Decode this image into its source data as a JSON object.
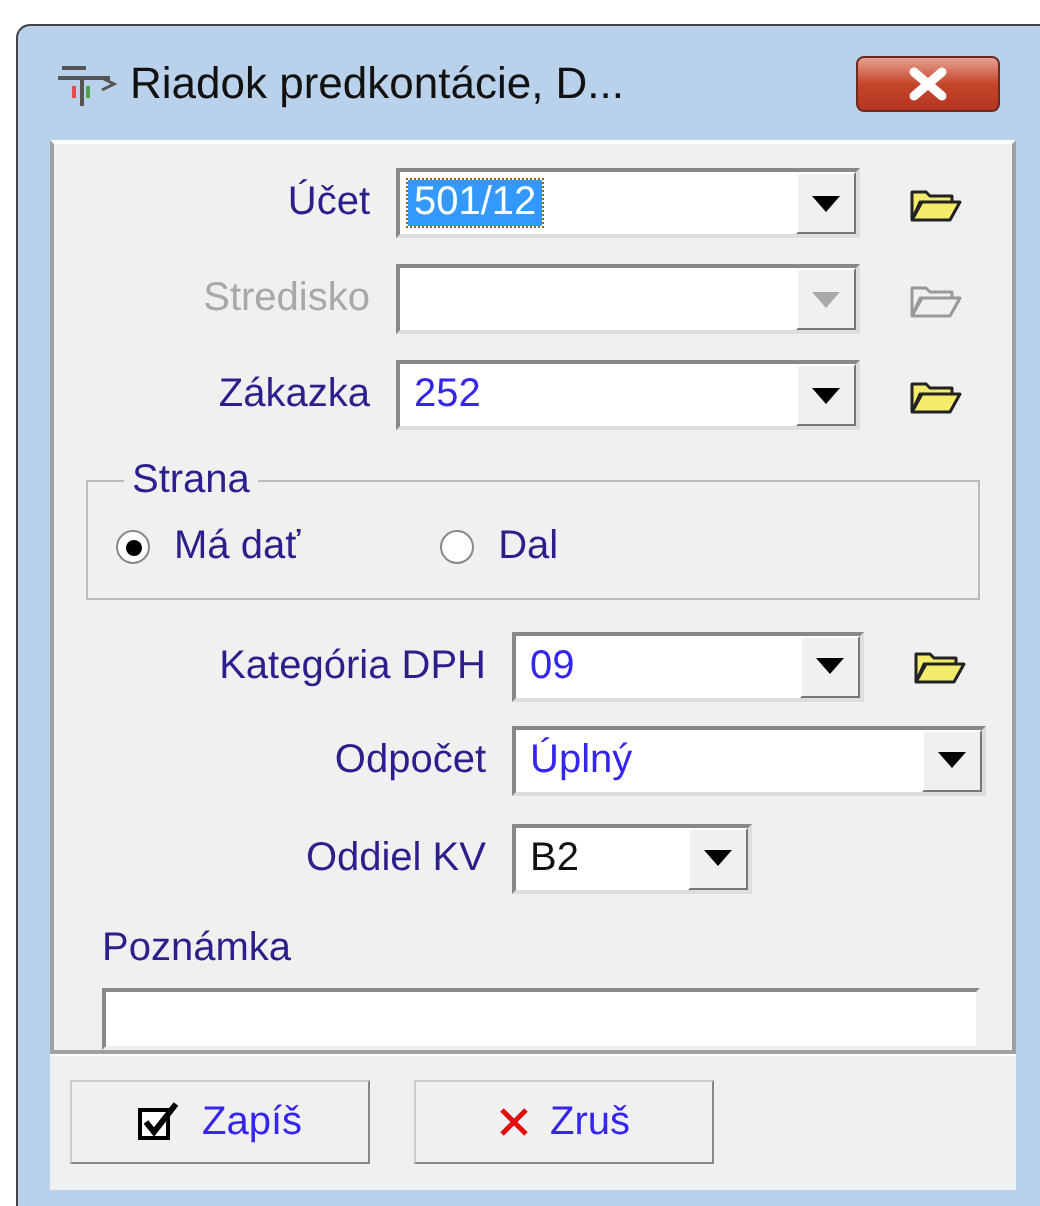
{
  "window": {
    "title": "Riadok predkontácie,  D..."
  },
  "top_fields": [
    {
      "label": "Účet",
      "value": "501/12",
      "focused": true,
      "disabled": false,
      "browse": true
    },
    {
      "label": "Stredisko",
      "focused": false,
      "disabled": true,
      "browse": true
    },
    {
      "label": "Zákazka",
      "value": "252",
      "focused": false,
      "disabled": false,
      "browse": true
    }
  ],
  "strana": {
    "title": "Strana",
    "options": [
      {
        "label": "Má dať",
        "selected": true
      },
      {
        "label": "Dal",
        "selected": false
      }
    ]
  },
  "vat_fields": [
    {
      "label": "Kategória DPH",
      "value": "09",
      "browse": true
    },
    {
      "label": "Odpočet",
      "value": "Úplný",
      "browse": false
    },
    {
      "label": "Oddiel KV",
      "value": "B2",
      "browse": false
    }
  ],
  "note": {
    "label": "Poznámka"
  },
  "buttons": [
    {
      "kind": "save",
      "label": "Zapíš"
    },
    {
      "kind": "cancel",
      "label": "Zruš"
    }
  ]
}
